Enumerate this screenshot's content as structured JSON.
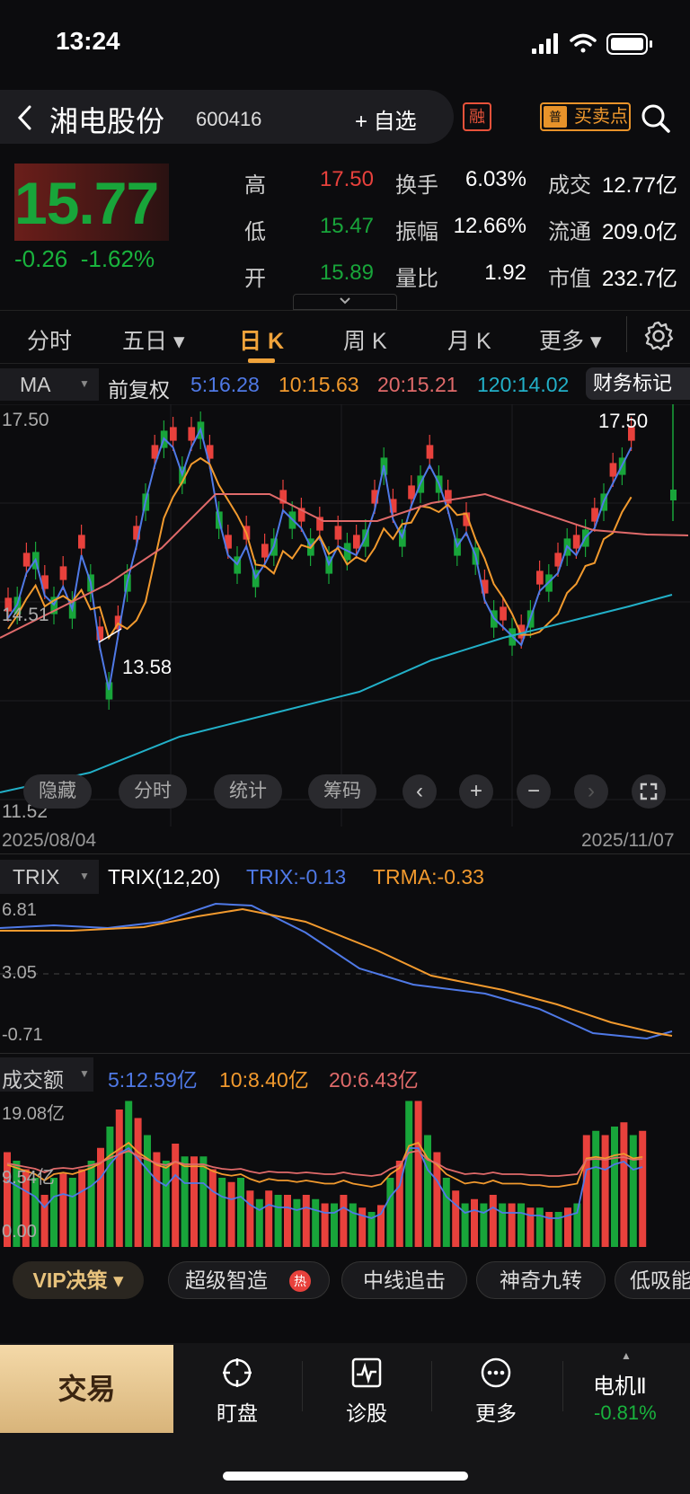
{
  "status": {
    "time": "13:24"
  },
  "header": {
    "name": "湘电股份",
    "code": "600416",
    "add_fav": "+ 自选",
    "rong": "融",
    "pu": "普",
    "buysell": "买卖点"
  },
  "quote": {
    "price": "15.77",
    "change": "-0.26",
    "change_pct": "-1.62%",
    "high_label": "高",
    "high": "17.50",
    "low_label": "低",
    "low": "15.47",
    "open_label": "开",
    "open": "15.89",
    "turnover_label": "换手",
    "turnover": "6.03%",
    "amplitude_label": "振幅",
    "amplitude": "12.66%",
    "volratio_label": "量比",
    "volratio": "1.92",
    "amount_label": "成交",
    "amount": "12.77亿",
    "float_label": "流通",
    "float": "209.0亿",
    "mcap_label": "市值",
    "mcap": "232.7亿"
  },
  "tabs": [
    "分时",
    "五日 ▾",
    "日 K",
    "周 K",
    "月 K",
    "更多 ▾"
  ],
  "active_tab": "日 K",
  "ma_bar": {
    "sel": "MA",
    "adj": "前复权",
    "ma5": "5:16.28",
    "ma10": "10:15.63",
    "ma20": "20:15.21",
    "ma120": "120:14.02",
    "fin": "财务标记"
  },
  "main_chart": {
    "high_label": "17.50",
    "hi_mark": "17.50",
    "mid_label": "14.51",
    "lo_mark": "13.58",
    "low_label": "11.52",
    "date_start": "2025/08/04",
    "date_end": "2025/11/07"
  },
  "controls": {
    "hide": "隐藏",
    "fenshi": "分时",
    "stats": "统计",
    "chips": "筹码"
  },
  "trix_bar": {
    "sel": "TRIX",
    "name": "TRIX(12,20)",
    "trix": "TRIX:-0.13",
    "trma": "TRMA:-0.33",
    "top": "6.81",
    "mid": "3.05",
    "bot": "-0.71"
  },
  "vol_bar": {
    "sel": "成交额",
    "ma5": "5:12.59亿",
    "ma10": "10:8.40亿",
    "ma20": "20:6.43亿",
    "top": "19.08亿",
    "mid": "9.54亿",
    "bot": "0.00"
  },
  "strategy": {
    "vip": "VIP决策 ▾",
    "items": [
      "超级智造",
      "中线追击",
      "神奇九转",
      "低吸能"
    ],
    "hot": "热"
  },
  "bottom": {
    "trade": "交易",
    "watch": "盯盘",
    "diag": "诊股",
    "more": "更多",
    "ticker": "电机Ⅱ",
    "ticker_chg": "-0.81%"
  },
  "colors": {
    "up": "#e8413c",
    "down": "#18a53a",
    "ma5": "#4f79e6",
    "ma10": "#f29a2e",
    "ma20": "#e06a6a",
    "ma120": "#22b0c8",
    "accent": "#f0a33b"
  }
}
